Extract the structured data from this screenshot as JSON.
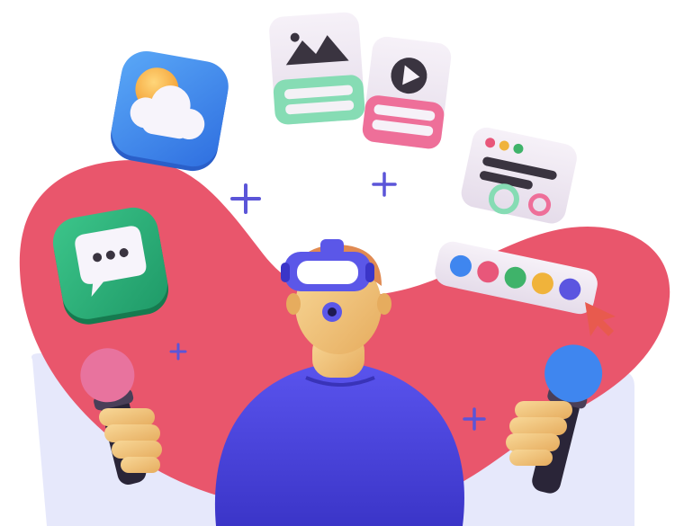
{
  "colors": {
    "blob": "#e9566c",
    "panel": "#e6e8fb",
    "body_suit": "#4b45e0",
    "skin": "#f2c77e",
    "hair": "#e08a52",
    "headset": "#5b57e8",
    "plus": "#5b55d8",
    "weather_tile": "#3f8fee",
    "chat_tile": "#2fb37a",
    "image_card_bar": "#86dcb4",
    "video_card_bar": "#ee6f99",
    "mic_left": "#e8739e",
    "mic_right": "#3f86ef",
    "palette": [
      "#3f86ef",
      "#e8577a",
      "#3fb36a",
      "#f0b33b",
      "#5b55e0"
    ]
  },
  "icons": [
    "weather-sun-cloud-icon",
    "image-card-icon",
    "video-play-card-icon",
    "message-window-icon",
    "chat-bubble-icon",
    "color-palette-icon",
    "cursor-arrow-icon",
    "microphone-icon",
    "vr-headset-icon",
    "plus-sign-icon"
  ]
}
